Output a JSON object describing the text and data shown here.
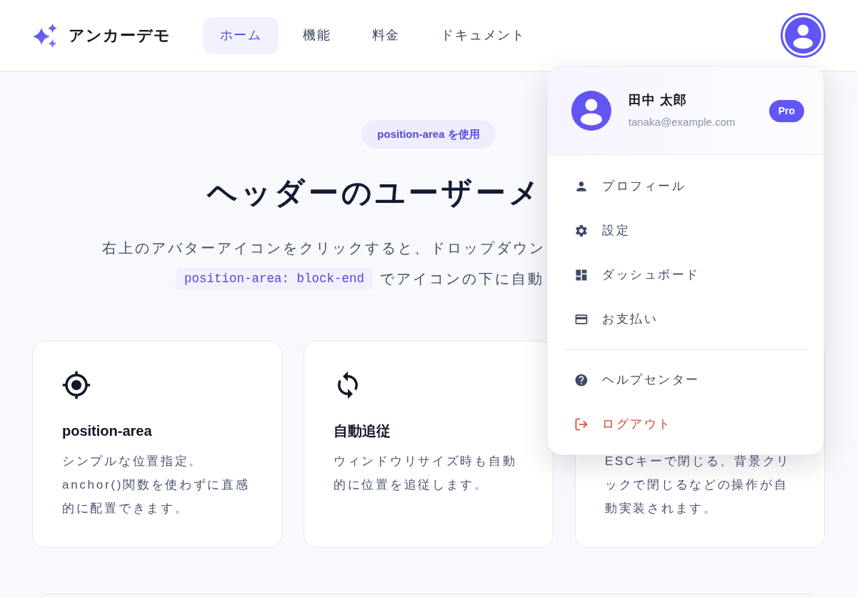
{
  "header": {
    "brand": "アンカーデモ",
    "nav": [
      {
        "label": "ホーム",
        "selected": true
      },
      {
        "label": "機能",
        "selected": false
      },
      {
        "label": "料金",
        "selected": false
      },
      {
        "label": "ドキュメント",
        "selected": false
      }
    ],
    "user_menu": {
      "expanded": true,
      "user": {
        "name": "田中 太郎",
        "email": "tanaka@example.com",
        "plan": "Pro"
      },
      "sections": [
        {
          "items": [
            {
              "label": "プロフィール",
              "danger": false
            },
            {
              "label": "設定",
              "danger": false
            },
            {
              "label": "ダッシュボード",
              "danger": false
            },
            {
              "label": "お支払い",
              "danger": false
            }
          ]
        },
        {
          "items": [
            {
              "label": "ヘルプセンター",
              "danger": false
            },
            {
              "label": "ログアウト",
              "danger": true
            }
          ]
        }
      ]
    }
  },
  "hero": {
    "badge": "position-area を使用",
    "heading": "ヘッダーのユーザーメ",
    "description_line_1": "右上のアバターアイコンをクリックすると、ドロップダウン",
    "description_line_2": {
      "code": "position-area: block-end",
      "text": "でアイコンの下に自動"
    }
  },
  "cards": [
    {
      "title": "position-area",
      "description": "シンプルな位置指定。anchor()関数を使わずに直感的に配置できます。"
    },
    {
      "title": "自動追従",
      "description": "ウィンドウリサイズ時も自動的に位置を追従します。"
    },
    {
      "description": "ESCキーで閉じる、背景クリックで閉じるなどの操作が自動実装されます。"
    }
  ]
}
